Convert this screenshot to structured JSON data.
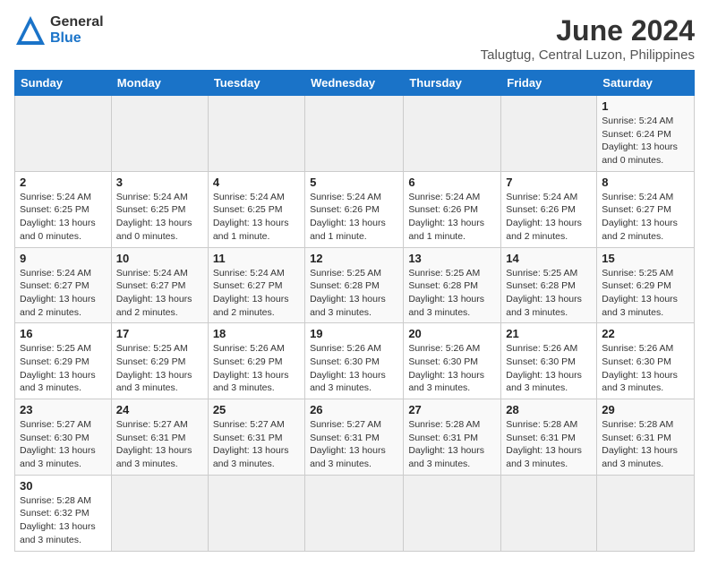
{
  "header": {
    "logo_general": "General",
    "logo_blue": "Blue",
    "title": "June 2024",
    "subtitle": "Talugtug, Central Luzon, Philippines"
  },
  "days_of_week": [
    "Sunday",
    "Monday",
    "Tuesday",
    "Wednesday",
    "Thursday",
    "Friday",
    "Saturday"
  ],
  "weeks": [
    [
      {
        "day": null,
        "info": null
      },
      {
        "day": null,
        "info": null
      },
      {
        "day": null,
        "info": null
      },
      {
        "day": null,
        "info": null
      },
      {
        "day": null,
        "info": null
      },
      {
        "day": null,
        "info": null
      },
      {
        "day": "1",
        "info": "Sunrise: 5:24 AM\nSunset: 6:24 PM\nDaylight: 13 hours and 0 minutes."
      }
    ],
    [
      {
        "day": "2",
        "info": "Sunrise: 5:24 AM\nSunset: 6:25 PM\nDaylight: 13 hours and 0 minutes."
      },
      {
        "day": "3",
        "info": "Sunrise: 5:24 AM\nSunset: 6:25 PM\nDaylight: 13 hours and 0 minutes."
      },
      {
        "day": "4",
        "info": "Sunrise: 5:24 AM\nSunset: 6:25 PM\nDaylight: 13 hours and 1 minute."
      },
      {
        "day": "5",
        "info": "Sunrise: 5:24 AM\nSunset: 6:26 PM\nDaylight: 13 hours and 1 minute."
      },
      {
        "day": "6",
        "info": "Sunrise: 5:24 AM\nSunset: 6:26 PM\nDaylight: 13 hours and 1 minute."
      },
      {
        "day": "7",
        "info": "Sunrise: 5:24 AM\nSunset: 6:26 PM\nDaylight: 13 hours and 2 minutes."
      },
      {
        "day": "8",
        "info": "Sunrise: 5:24 AM\nSunset: 6:27 PM\nDaylight: 13 hours and 2 minutes."
      }
    ],
    [
      {
        "day": "9",
        "info": "Sunrise: 5:24 AM\nSunset: 6:27 PM\nDaylight: 13 hours and 2 minutes."
      },
      {
        "day": "10",
        "info": "Sunrise: 5:24 AM\nSunset: 6:27 PM\nDaylight: 13 hours and 2 minutes."
      },
      {
        "day": "11",
        "info": "Sunrise: 5:24 AM\nSunset: 6:27 PM\nDaylight: 13 hours and 2 minutes."
      },
      {
        "day": "12",
        "info": "Sunrise: 5:25 AM\nSunset: 6:28 PM\nDaylight: 13 hours and 3 minutes."
      },
      {
        "day": "13",
        "info": "Sunrise: 5:25 AM\nSunset: 6:28 PM\nDaylight: 13 hours and 3 minutes."
      },
      {
        "day": "14",
        "info": "Sunrise: 5:25 AM\nSunset: 6:28 PM\nDaylight: 13 hours and 3 minutes."
      },
      {
        "day": "15",
        "info": "Sunrise: 5:25 AM\nSunset: 6:29 PM\nDaylight: 13 hours and 3 minutes."
      }
    ],
    [
      {
        "day": "16",
        "info": "Sunrise: 5:25 AM\nSunset: 6:29 PM\nDaylight: 13 hours and 3 minutes."
      },
      {
        "day": "17",
        "info": "Sunrise: 5:25 AM\nSunset: 6:29 PM\nDaylight: 13 hours and 3 minutes."
      },
      {
        "day": "18",
        "info": "Sunrise: 5:26 AM\nSunset: 6:29 PM\nDaylight: 13 hours and 3 minutes."
      },
      {
        "day": "19",
        "info": "Sunrise: 5:26 AM\nSunset: 6:30 PM\nDaylight: 13 hours and 3 minutes."
      },
      {
        "day": "20",
        "info": "Sunrise: 5:26 AM\nSunset: 6:30 PM\nDaylight: 13 hours and 3 minutes."
      },
      {
        "day": "21",
        "info": "Sunrise: 5:26 AM\nSunset: 6:30 PM\nDaylight: 13 hours and 3 minutes."
      },
      {
        "day": "22",
        "info": "Sunrise: 5:26 AM\nSunset: 6:30 PM\nDaylight: 13 hours and 3 minutes."
      }
    ],
    [
      {
        "day": "23",
        "info": "Sunrise: 5:27 AM\nSunset: 6:30 PM\nDaylight: 13 hours and 3 minutes."
      },
      {
        "day": "24",
        "info": "Sunrise: 5:27 AM\nSunset: 6:31 PM\nDaylight: 13 hours and 3 minutes."
      },
      {
        "day": "25",
        "info": "Sunrise: 5:27 AM\nSunset: 6:31 PM\nDaylight: 13 hours and 3 minutes."
      },
      {
        "day": "26",
        "info": "Sunrise: 5:27 AM\nSunset: 6:31 PM\nDaylight: 13 hours and 3 minutes."
      },
      {
        "day": "27",
        "info": "Sunrise: 5:28 AM\nSunset: 6:31 PM\nDaylight: 13 hours and 3 minutes."
      },
      {
        "day": "28",
        "info": "Sunrise: 5:28 AM\nSunset: 6:31 PM\nDaylight: 13 hours and 3 minutes."
      },
      {
        "day": "29",
        "info": "Sunrise: 5:28 AM\nSunset: 6:31 PM\nDaylight: 13 hours and 3 minutes."
      }
    ],
    [
      {
        "day": "30",
        "info": "Sunrise: 5:28 AM\nSunset: 6:32 PM\nDaylight: 13 hours and 3 minutes."
      },
      {
        "day": null,
        "info": null
      },
      {
        "day": null,
        "info": null
      },
      {
        "day": null,
        "info": null
      },
      {
        "day": null,
        "info": null
      },
      {
        "day": null,
        "info": null
      },
      {
        "day": null,
        "info": null
      }
    ]
  ]
}
